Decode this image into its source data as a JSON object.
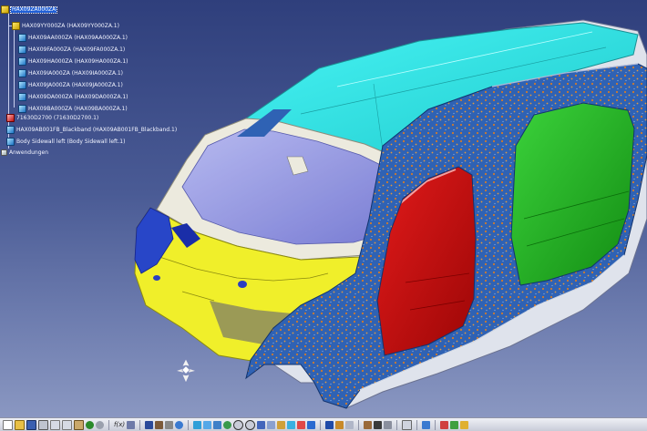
{
  "tree": {
    "root": "HAX09ZA000ZA",
    "items": [
      "HAX09YY000ZA (HAX09YY000ZA.1)",
      "HAX09AA000ZA (HAX09AA000ZA.1)",
      "HAX09FA000ZA (HAX09FA000ZA.1)",
      "HAX09HA000ZA (HAX09HA000ZA.1)",
      "HAX09IA000ZA (HAX09IA000ZA.1)",
      "HAX09JA000ZA (HAX09JA000ZA.1)",
      "HAX09DA000ZA (HAX09DA000ZA.1)",
      "HAX09BA000ZA (HAX09BA000ZA.1)",
      "71630D2700 (71630D2700.1)",
      "HAX09AB001FB_Blackband (HAX09AB001FB_Blackband.1)",
      "Body Sidewall left (Body Sidewall left.1)",
      "Anwendungen"
    ]
  },
  "toolbar": {
    "fx_label": "f(x)"
  },
  "colors": {
    "background_top": "#2f3f7c",
    "roof": "#34e6e6",
    "windshield_frame": "#eceade",
    "glass": "#8b8fe0",
    "front_end": "#f0ef2a",
    "body_side": "#2f62b4",
    "red_door": "#cc0b0b",
    "green_door": "#1eb21e"
  },
  "icons": [
    "assembly-icon",
    "part-icon",
    "compass-icon",
    "new-icon",
    "open-icon",
    "save-icon",
    "print-icon",
    "undo-icon",
    "redo-icon",
    "fx-icon",
    "pan-icon",
    "rotate-icon",
    "zoom-in-icon",
    "zoom-out-icon",
    "fit-all-icon",
    "normal-view-icon",
    "render-style-icon",
    "hide-show-icon"
  ]
}
